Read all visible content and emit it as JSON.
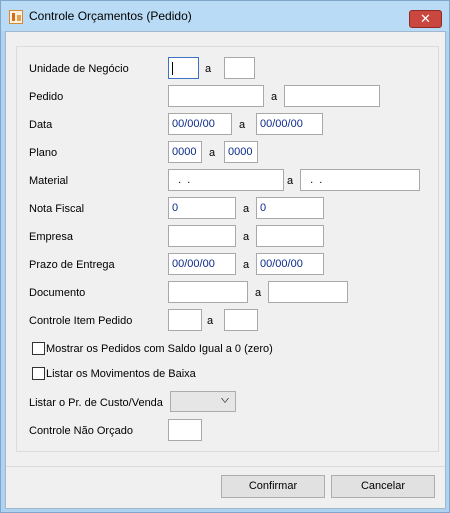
{
  "window": {
    "title": "Controle Orçamentos (Pedido)",
    "close_glyph": "✕"
  },
  "fields": {
    "unidade": {
      "label": "Unidade de Negócio",
      "sep": "a",
      "from": "",
      "to": ""
    },
    "pedido": {
      "label": "Pedido",
      "sep": "a",
      "from": "",
      "to": ""
    },
    "data": {
      "label": "Data",
      "sep": "a",
      "from": "00/00/00",
      "to": "00/00/00"
    },
    "plano": {
      "label": "Plano",
      "sep": "a",
      "from": "0000",
      "to": "0000"
    },
    "material": {
      "label": "Material",
      "sep": "a",
      "from": "  .  .",
      "to": "  .  ."
    },
    "nota_fiscal": {
      "label": "Nota Fiscal",
      "sep": "a",
      "from": "0",
      "to": "0"
    },
    "empresa": {
      "label": "Empresa",
      "sep": "a",
      "from": "",
      "to": ""
    },
    "prazo_entrega": {
      "label": "Prazo de Entrega",
      "sep": "a",
      "from": "00/00/00",
      "to": "00/00/00"
    },
    "documento": {
      "label": "Documento",
      "sep": "a",
      "from": "",
      "to": ""
    },
    "controle_item": {
      "label": "Controle Item Pedido",
      "sep": "a",
      "from": "",
      "to": ""
    }
  },
  "options": {
    "saldo_zero": {
      "label": "Mostrar os Pedidos com Saldo Igual a 0 (zero)",
      "checked": false
    },
    "movimentos_baixa": {
      "label": "Listar os Movimentos de Baixa",
      "checked": false
    }
  },
  "preco": {
    "label": "Listar o Pr. de Custo/Venda",
    "selected": ""
  },
  "nao_orcado": {
    "label": "Controle Não Orçado",
    "value": ""
  },
  "buttons": {
    "confirmar": "Confirmar",
    "cancelar": "Cancelar"
  }
}
